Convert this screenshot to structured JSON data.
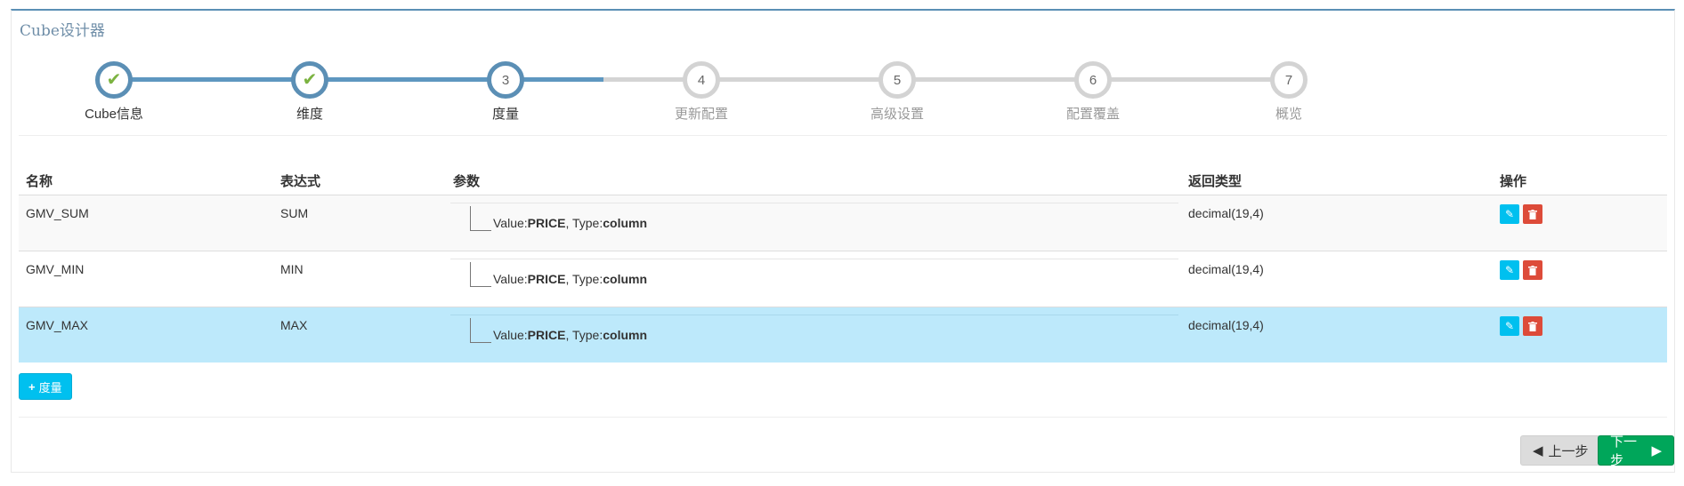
{
  "panel": {
    "title": "Cube设计器"
  },
  "wizard": {
    "steps": [
      {
        "number": "1",
        "label": "Cube信息",
        "state": "done"
      },
      {
        "number": "2",
        "label": "维度",
        "state": "done"
      },
      {
        "number": "3",
        "label": "度量",
        "state": "active"
      },
      {
        "number": "4",
        "label": "更新配置",
        "state": "pending"
      },
      {
        "number": "5",
        "label": "高级设置",
        "state": "pending"
      },
      {
        "number": "6",
        "label": "配置覆盖",
        "state": "pending"
      },
      {
        "number": "7",
        "label": "概览",
        "state": "pending"
      }
    ]
  },
  "table": {
    "headers": {
      "name": "名称",
      "expression": "表达式",
      "params": "参数",
      "return_type": "返回类型",
      "actions": "操作"
    },
    "rows": [
      {
        "name": "GMV_SUM",
        "expression": "SUM",
        "value_label": "Value:",
        "value": "PRICE",
        "type_label": ", Type:",
        "type": "column",
        "return_type": "decimal(19,4)"
      },
      {
        "name": "GMV_MIN",
        "expression": "MIN",
        "value_label": "Value:",
        "value": "PRICE",
        "type_label": ", Type:",
        "type": "column",
        "return_type": "decimal(19,4)"
      },
      {
        "name": "GMV_MAX",
        "expression": "MAX",
        "value_label": "Value:",
        "value": "PRICE",
        "type_label": ", Type:",
        "type": "column",
        "return_type": "decimal(19,4)"
      }
    ]
  },
  "buttons": {
    "add_measure": "度量",
    "prev": "上一步",
    "next": "下一步"
  },
  "colors": {
    "accent": "#5b8fb5",
    "check": "#7cb341",
    "selected_row": "#bde9fb",
    "edit": "#00c0ef",
    "delete": "#dd4b39",
    "next": "#00a65a"
  }
}
